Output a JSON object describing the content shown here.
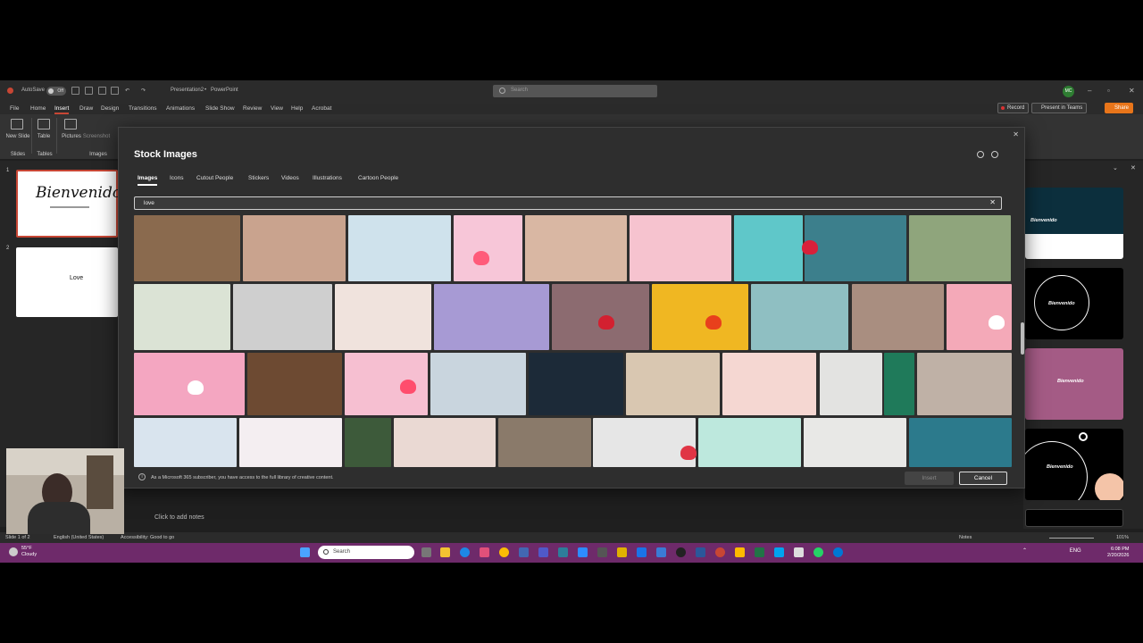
{
  "titlebar": {
    "autosave": "AutoSave",
    "autosave_state": "Off",
    "doc_title": "Presentation2",
    "separator": "•",
    "app": "PowerPoint",
    "search_placeholder": "Search",
    "user_initials": "MC"
  },
  "menu": {
    "items": [
      "File",
      "Home",
      "Insert",
      "Draw",
      "Design",
      "Transitions",
      "Animations",
      "Slide Show",
      "Review",
      "View",
      "Help",
      "Acrobat"
    ],
    "active": "Insert",
    "record": "Record",
    "present": "Present in Teams",
    "share": "Share"
  },
  "ribbon": {
    "new_slide": "New Slide",
    "table": "Table",
    "pictures": "Pictures",
    "screenshot": "Screenshot",
    "group_slides": "Slides",
    "group_tables": "Tables",
    "group_images": "Images"
  },
  "slides": {
    "s1_num": "1",
    "s1_title": "Bienvenido",
    "s2_num": "2",
    "s2_title": "Love"
  },
  "designer": {
    "t1": "Bienvenido",
    "t2": "Bienvenido",
    "t3": "Bienvenido",
    "t4": "Bienvenido"
  },
  "notes": {
    "placeholder": "Click to add notes"
  },
  "dialog": {
    "title": "Stock Images",
    "tabs": [
      "Images",
      "Icons",
      "Cutout People",
      "Stickers",
      "Videos",
      "Illustrations",
      "Cartoon People"
    ],
    "active_tab": "Images",
    "search_value": "love",
    "footer_note": "As a Microsoft 365 subscriber, you have access to the full library of creative content.",
    "insert": "Insert",
    "cancel": "Cancel"
  },
  "statusbar": {
    "slide": "Slide 1 of 2",
    "language": "English (United States)",
    "accessibility": "Accessibility: Good to go",
    "notes": "Notes",
    "zoom": "101%"
  },
  "taskbar": {
    "temp": "55°F",
    "weather": "Cloudy",
    "search": "Search",
    "lang": "ENG",
    "time": "6:08 PM",
    "date": "2/20/2026"
  },
  "colors": {
    "accent": "#c74634",
    "taskbar": "#6e2a6a",
    "share": "#e8751a"
  }
}
